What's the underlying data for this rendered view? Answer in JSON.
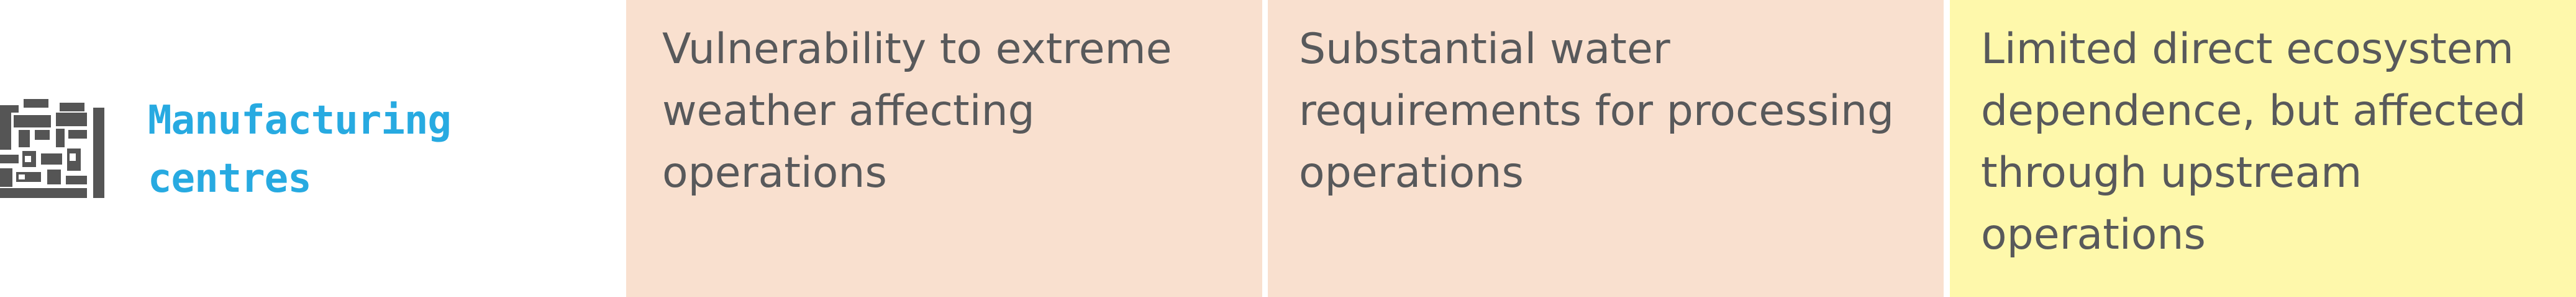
{
  "row": {
    "label": "Manufacturing centres",
    "icon": "factory-icon",
    "cells": [
      {
        "text": "Vulnerability to extreme weather affecting operations",
        "background": "#f9e0cf"
      },
      {
        "text": "Substantial water requirements for processing operations",
        "background": "#f9e0cf"
      },
      {
        "text": "Limited direct ecosystem dependence, but affected through upstream operations",
        "background": "#fef8ab"
      }
    ]
  },
  "colors": {
    "label": "#27aae1",
    "icon": "#555555",
    "body_text": "#58595b"
  }
}
